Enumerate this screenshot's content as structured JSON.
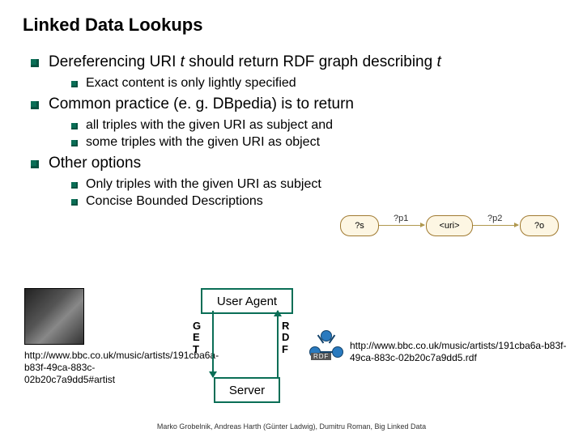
{
  "title": "Linked Data Lookups",
  "bullets": {
    "b1_pre": "Dereferencing URI ",
    "b1_var1": "t",
    "b1_mid": " should return RDF graph describing ",
    "b1_var2": "t",
    "b1_sub1": "Exact content is only lightly specified",
    "b2": "Common practice (e. g. DBpedia) is to return",
    "b2_sub1": "all triples with the given URI as subject and",
    "b2_sub2": "some triples with the given URI as object",
    "b3": "Other options",
    "b3_sub1": "Only triples with the given URI as subject",
    "b3_sub2": "Concise Bounded Descriptions"
  },
  "graph": {
    "n_s": "?s",
    "n_uri": "<uri>",
    "n_o": "?o",
    "e1": "?p1",
    "e2": "?p2"
  },
  "diagram": {
    "user_agent": "User Agent",
    "server": "Server",
    "get": "G\nE\nT",
    "rdf": "R\nD\nF",
    "rdf_badge": "RDF",
    "url_left": "http://www.bbc.co.uk/music/artists/191cba6a-b83f-49ca-883c-02b20c7a9dd5#artist",
    "url_right": "http://www.bbc.co.uk/music/artists/191cba6a-b83f-49ca-883c-02b20c7a9dd5.rdf"
  },
  "footer": "Marko Grobelnik, Andreas Harth (Günter Ladwig), Dumitru Roman, Big Linked Data"
}
